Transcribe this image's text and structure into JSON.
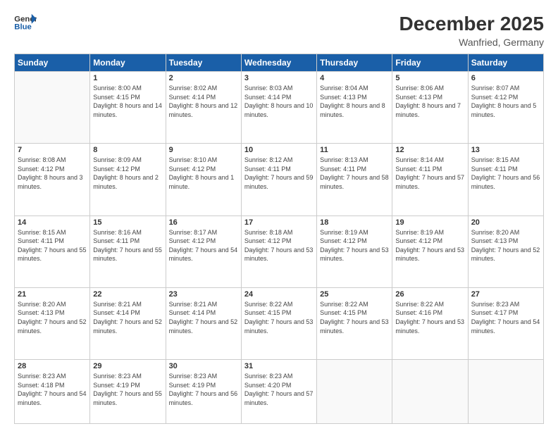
{
  "logo": {
    "text_general": "General",
    "text_blue": "Blue"
  },
  "header": {
    "month": "December 2025",
    "location": "Wanfried, Germany"
  },
  "weekdays": [
    "Sunday",
    "Monday",
    "Tuesday",
    "Wednesday",
    "Thursday",
    "Friday",
    "Saturday"
  ],
  "weeks": [
    [
      {
        "day": "",
        "sunrise": "",
        "sunset": "",
        "daylight": ""
      },
      {
        "day": "1",
        "sunrise": "Sunrise: 8:00 AM",
        "sunset": "Sunset: 4:15 PM",
        "daylight": "Daylight: 8 hours and 14 minutes."
      },
      {
        "day": "2",
        "sunrise": "Sunrise: 8:02 AM",
        "sunset": "Sunset: 4:14 PM",
        "daylight": "Daylight: 8 hours and 12 minutes."
      },
      {
        "day": "3",
        "sunrise": "Sunrise: 8:03 AM",
        "sunset": "Sunset: 4:14 PM",
        "daylight": "Daylight: 8 hours and 10 minutes."
      },
      {
        "day": "4",
        "sunrise": "Sunrise: 8:04 AM",
        "sunset": "Sunset: 4:13 PM",
        "daylight": "Daylight: 8 hours and 8 minutes."
      },
      {
        "day": "5",
        "sunrise": "Sunrise: 8:06 AM",
        "sunset": "Sunset: 4:13 PM",
        "daylight": "Daylight: 8 hours and 7 minutes."
      },
      {
        "day": "6",
        "sunrise": "Sunrise: 8:07 AM",
        "sunset": "Sunset: 4:12 PM",
        "daylight": "Daylight: 8 hours and 5 minutes."
      }
    ],
    [
      {
        "day": "7",
        "sunrise": "Sunrise: 8:08 AM",
        "sunset": "Sunset: 4:12 PM",
        "daylight": "Daylight: 8 hours and 3 minutes."
      },
      {
        "day": "8",
        "sunrise": "Sunrise: 8:09 AM",
        "sunset": "Sunset: 4:12 PM",
        "daylight": "Daylight: 8 hours and 2 minutes."
      },
      {
        "day": "9",
        "sunrise": "Sunrise: 8:10 AM",
        "sunset": "Sunset: 4:12 PM",
        "daylight": "Daylight: 8 hours and 1 minute."
      },
      {
        "day": "10",
        "sunrise": "Sunrise: 8:12 AM",
        "sunset": "Sunset: 4:11 PM",
        "daylight": "Daylight: 7 hours and 59 minutes."
      },
      {
        "day": "11",
        "sunrise": "Sunrise: 8:13 AM",
        "sunset": "Sunset: 4:11 PM",
        "daylight": "Daylight: 7 hours and 58 minutes."
      },
      {
        "day": "12",
        "sunrise": "Sunrise: 8:14 AM",
        "sunset": "Sunset: 4:11 PM",
        "daylight": "Daylight: 7 hours and 57 minutes."
      },
      {
        "day": "13",
        "sunrise": "Sunrise: 8:15 AM",
        "sunset": "Sunset: 4:11 PM",
        "daylight": "Daylight: 7 hours and 56 minutes."
      }
    ],
    [
      {
        "day": "14",
        "sunrise": "Sunrise: 8:15 AM",
        "sunset": "Sunset: 4:11 PM",
        "daylight": "Daylight: 7 hours and 55 minutes."
      },
      {
        "day": "15",
        "sunrise": "Sunrise: 8:16 AM",
        "sunset": "Sunset: 4:11 PM",
        "daylight": "Daylight: 7 hours and 55 minutes."
      },
      {
        "day": "16",
        "sunrise": "Sunrise: 8:17 AM",
        "sunset": "Sunset: 4:12 PM",
        "daylight": "Daylight: 7 hours and 54 minutes."
      },
      {
        "day": "17",
        "sunrise": "Sunrise: 8:18 AM",
        "sunset": "Sunset: 4:12 PM",
        "daylight": "Daylight: 7 hours and 53 minutes."
      },
      {
        "day": "18",
        "sunrise": "Sunrise: 8:19 AM",
        "sunset": "Sunset: 4:12 PM",
        "daylight": "Daylight: 7 hours and 53 minutes."
      },
      {
        "day": "19",
        "sunrise": "Sunrise: 8:19 AM",
        "sunset": "Sunset: 4:12 PM",
        "daylight": "Daylight: 7 hours and 53 minutes."
      },
      {
        "day": "20",
        "sunrise": "Sunrise: 8:20 AM",
        "sunset": "Sunset: 4:13 PM",
        "daylight": "Daylight: 7 hours and 52 minutes."
      }
    ],
    [
      {
        "day": "21",
        "sunrise": "Sunrise: 8:20 AM",
        "sunset": "Sunset: 4:13 PM",
        "daylight": "Daylight: 7 hours and 52 minutes."
      },
      {
        "day": "22",
        "sunrise": "Sunrise: 8:21 AM",
        "sunset": "Sunset: 4:14 PM",
        "daylight": "Daylight: 7 hours and 52 minutes."
      },
      {
        "day": "23",
        "sunrise": "Sunrise: 8:21 AM",
        "sunset": "Sunset: 4:14 PM",
        "daylight": "Daylight: 7 hours and 52 minutes."
      },
      {
        "day": "24",
        "sunrise": "Sunrise: 8:22 AM",
        "sunset": "Sunset: 4:15 PM",
        "daylight": "Daylight: 7 hours and 53 minutes."
      },
      {
        "day": "25",
        "sunrise": "Sunrise: 8:22 AM",
        "sunset": "Sunset: 4:15 PM",
        "daylight": "Daylight: 7 hours and 53 minutes."
      },
      {
        "day": "26",
        "sunrise": "Sunrise: 8:22 AM",
        "sunset": "Sunset: 4:16 PM",
        "daylight": "Daylight: 7 hours and 53 minutes."
      },
      {
        "day": "27",
        "sunrise": "Sunrise: 8:23 AM",
        "sunset": "Sunset: 4:17 PM",
        "daylight": "Daylight: 7 hours and 54 minutes."
      }
    ],
    [
      {
        "day": "28",
        "sunrise": "Sunrise: 8:23 AM",
        "sunset": "Sunset: 4:18 PM",
        "daylight": "Daylight: 7 hours and 54 minutes."
      },
      {
        "day": "29",
        "sunrise": "Sunrise: 8:23 AM",
        "sunset": "Sunset: 4:19 PM",
        "daylight": "Daylight: 7 hours and 55 minutes."
      },
      {
        "day": "30",
        "sunrise": "Sunrise: 8:23 AM",
        "sunset": "Sunset: 4:19 PM",
        "daylight": "Daylight: 7 hours and 56 minutes."
      },
      {
        "day": "31",
        "sunrise": "Sunrise: 8:23 AM",
        "sunset": "Sunset: 4:20 PM",
        "daylight": "Daylight: 7 hours and 57 minutes."
      },
      {
        "day": "",
        "sunrise": "",
        "sunset": "",
        "daylight": ""
      },
      {
        "day": "",
        "sunrise": "",
        "sunset": "",
        "daylight": ""
      },
      {
        "day": "",
        "sunrise": "",
        "sunset": "",
        "daylight": ""
      }
    ]
  ]
}
